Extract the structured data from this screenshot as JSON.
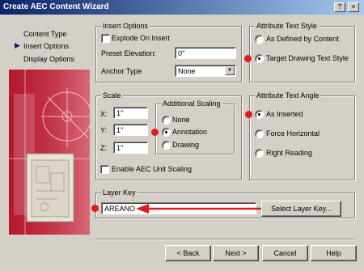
{
  "window": {
    "title": "Create AEC Content Wizard",
    "btn_help": "?",
    "btn_close": "×"
  },
  "nav": {
    "items": [
      {
        "label": "Content Type",
        "active": false
      },
      {
        "label": "Insert Options",
        "active": true
      },
      {
        "label": "Display Options",
        "active": false
      }
    ]
  },
  "insert_options": {
    "title": "Insert Options",
    "explode_label": "Explode On Insert",
    "explode_checked": false,
    "preset_elevation_label": "Preset Elevation:",
    "preset_elevation_value": "0\"",
    "anchor_type_label": "Anchor Type",
    "anchor_type_value": "None"
  },
  "attribute_text_style": {
    "title": "Attribute Text Style",
    "options": [
      "As Defined by Content",
      "Target Drawing Text Style"
    ],
    "selected": 1
  },
  "scale": {
    "title": "Scale",
    "x_label": "X:",
    "x_value": "1\"",
    "y_label": "Y:",
    "y_value": "1\"",
    "z_label": "Z:",
    "z_value": "1\"",
    "additional_title": "Additional Scaling",
    "additional_options": [
      "None",
      "Annotation",
      "Drawing"
    ],
    "additional_selected": 1,
    "enable_unit_label": "Enable AEC Unit Scaling",
    "enable_unit_checked": false
  },
  "attribute_text_angle": {
    "title": "Attribute Text Angle",
    "options": [
      "As Inserted",
      "Force Horizontal",
      "Right Reading"
    ],
    "selected": 0
  },
  "layer_key": {
    "title": "Layer Key",
    "value": "AREANO",
    "select_button": "Select Layer Key..."
  },
  "footer": {
    "back": "< Back",
    "next": "Next >",
    "cancel": "Cancel",
    "help": "Help"
  },
  "colors": {
    "annotation_red": "#e11a1a",
    "titlebar": "#0a246a"
  }
}
